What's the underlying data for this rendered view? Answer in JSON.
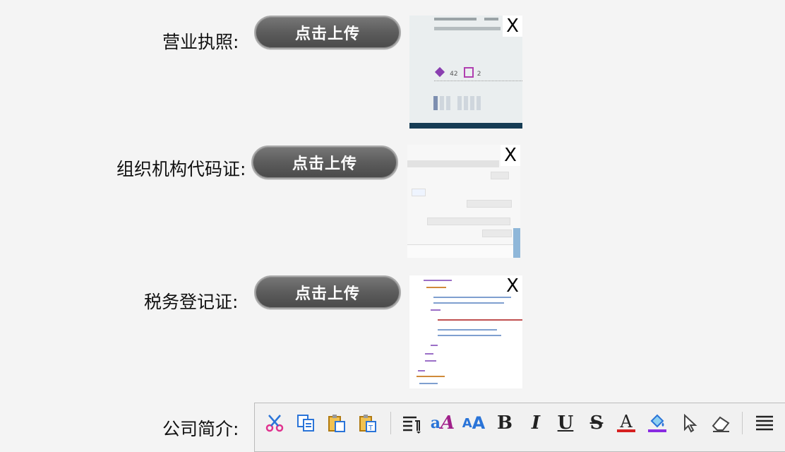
{
  "form": {
    "business_license": {
      "label": "营业执照:",
      "button": "点击上传",
      "close": "X"
    },
    "org_code": {
      "label": "组织机构代码证:",
      "button": "点击上传",
      "close": "X"
    },
    "tax_reg": {
      "label": "税务登记证:",
      "button": "点击上传",
      "close": "X"
    },
    "company_intro": {
      "label": "公司简介:"
    }
  },
  "thumb1": {
    "count_a": "42",
    "count_b": "2"
  },
  "editor_toolbar": {
    "icons": [
      "cut-icon",
      "copy-icon",
      "paste-icon",
      "paste-text-icon",
      "paragraph-format-icon",
      "font-family-icon",
      "font-size-icon",
      "bold-icon",
      "italic-icon",
      "underline-icon",
      "strikethrough-icon",
      "font-color-icon",
      "background-color-icon",
      "select-all-icon",
      "remove-format-icon",
      "justify-icon"
    ],
    "glyphs": {
      "bold": "B",
      "italic": "I",
      "underline": "U",
      "strike": "S",
      "fontcolor": "A",
      "fontsize": "A",
      "fontfamily": "a"
    },
    "colors": {
      "cut": "#e0338f",
      "copy": "#2a74d8",
      "font_color_bar": "#d62020",
      "bg_color_bar": "#8a2be2",
      "fontfamily_accent": "#a0208a"
    }
  }
}
